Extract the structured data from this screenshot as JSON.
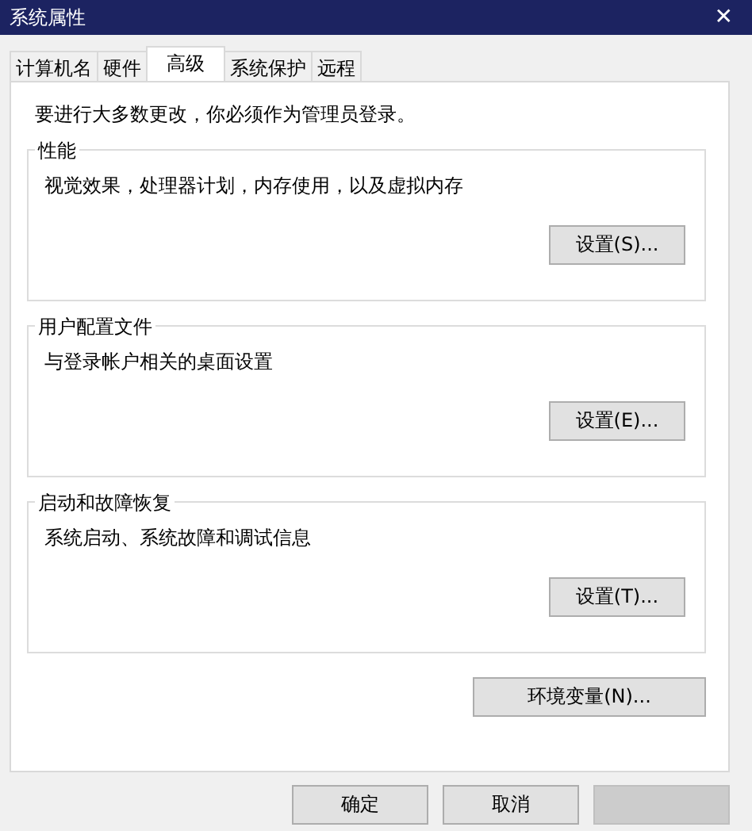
{
  "window": {
    "title": "系统属性",
    "close": "✕"
  },
  "tabs": [
    {
      "label": "计算机名",
      "selected": false
    },
    {
      "label": "硬件",
      "selected": false
    },
    {
      "label": "高级",
      "selected": true
    },
    {
      "label": "系统保护",
      "selected": false
    },
    {
      "label": "远程",
      "selected": false
    }
  ],
  "notice": "要进行大多数更改，你必须作为管理员登录。",
  "groups": [
    {
      "title": "性能",
      "description": "视觉效果，处理器计划，内存使用，以及虚拟内存",
      "button": "设置(S)..."
    },
    {
      "title": "用户配置文件",
      "description": "与登录帐户相关的桌面设置",
      "button": "设置(E)..."
    },
    {
      "title": "启动和故障恢复",
      "description": "系统启动、系统故障和调试信息",
      "button": "设置(T)..."
    }
  ],
  "env_button": "环境变量(N)...",
  "buttons": [
    {
      "label": "确定",
      "disabled": false
    },
    {
      "label": "取消",
      "disabled": false
    },
    {
      "disabled": true
    }
  ]
}
